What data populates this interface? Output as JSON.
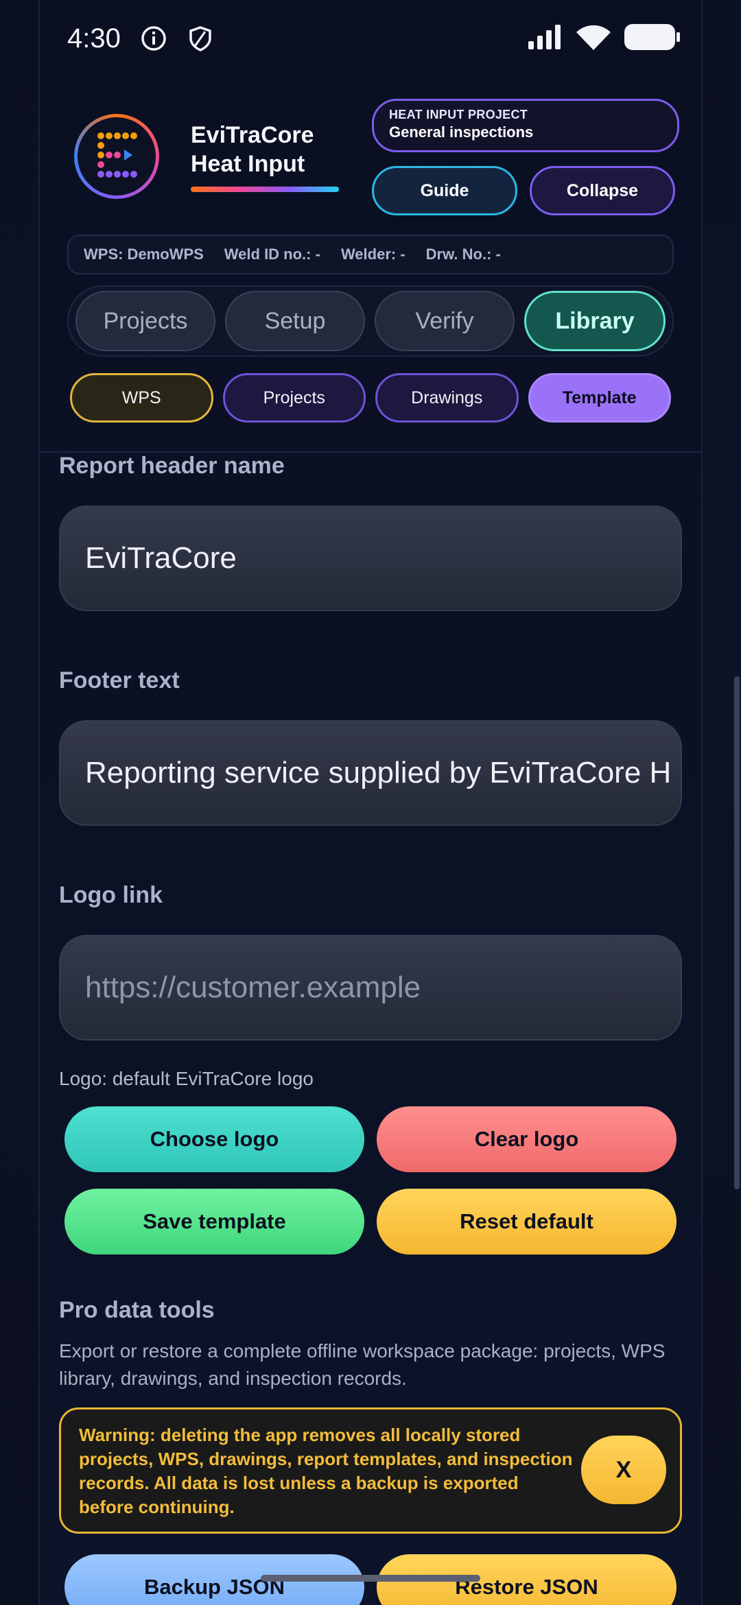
{
  "status_bar": {
    "time": "4:30"
  },
  "header": {
    "brand_line1": "EviTraCore",
    "brand_line2": "Heat Input",
    "project_label": "HEAT INPUT PROJECT",
    "project_value": "General inspections",
    "guide_label": "Guide",
    "collapse_label": "Collapse",
    "meta": [
      "WPS: DemoWPS",
      "Weld ID no.: -",
      "Welder: -",
      "Drw. No.: -"
    ]
  },
  "tabs": [
    {
      "label": "Projects",
      "active": false
    },
    {
      "label": "Setup",
      "active": false
    },
    {
      "label": "Verify",
      "active": false
    },
    {
      "label": "Library",
      "active": true
    }
  ],
  "subtabs": [
    {
      "label": "WPS",
      "active": false
    },
    {
      "label": "Projects",
      "active": false
    },
    {
      "label": "Drawings",
      "active": false
    },
    {
      "label": "Template",
      "active": true
    }
  ],
  "form": {
    "report_header_label": "Report header name",
    "report_header_value": "EviTraCore",
    "footer_label": "Footer text",
    "footer_value": "Reporting service supplied by EviTraCore H",
    "logo_link_label": "Logo link",
    "logo_link_placeholder": "https://customer.example",
    "logo_note": "Logo: default EviTraCore logo"
  },
  "buttons": {
    "choose_logo": "Choose logo",
    "clear_logo": "Clear logo",
    "save_template": "Save template",
    "reset_default": "Reset default",
    "backup_json": "Backup JSON",
    "restore_json": "Restore JSON"
  },
  "pro": {
    "title": "Pro data tools",
    "description": "Export or restore a complete offline workspace package: projects, WPS library, drawings, and inspection records.",
    "warning": "Warning: deleting the app removes all locally stored projects, WPS, drawings, report templates, and inspection records. All data is lost unless a backup is exported before continuing.",
    "warning_close": "X"
  },
  "colors": {
    "accent_teal": "#5fe3cc",
    "accent_purple": "#9a72f7",
    "warning": "#f3bd3a"
  }
}
